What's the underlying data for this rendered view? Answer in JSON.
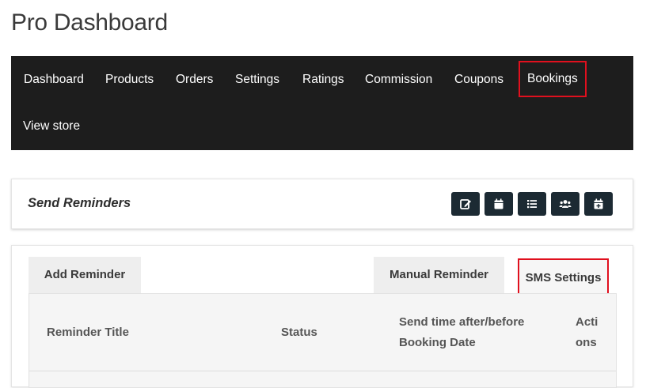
{
  "page": {
    "title": "Pro Dashboard"
  },
  "nav": {
    "items": [
      {
        "label": "Dashboard"
      },
      {
        "label": "Products"
      },
      {
        "label": "Orders"
      },
      {
        "label": "Settings"
      },
      {
        "label": "Ratings"
      },
      {
        "label": "Commission"
      },
      {
        "label": "Coupons"
      },
      {
        "label": "Bookings"
      },
      {
        "label": "View store"
      }
    ]
  },
  "reminders": {
    "title": "Send Reminders",
    "toolbar": [
      {
        "icon": "edit-icon"
      },
      {
        "icon": "calendar-icon"
      },
      {
        "icon": "list-icon"
      },
      {
        "icon": "users-icon"
      },
      {
        "icon": "calendar-plus-icon"
      }
    ]
  },
  "tabs": [
    {
      "label": "Add Reminder"
    },
    {
      "label": "Manual Reminder"
    },
    {
      "label": "SMS Settings"
    }
  ],
  "table": {
    "columns": [
      {
        "label": "Reminder Title"
      },
      {
        "label": "Status"
      },
      {
        "label": "Send time after/before Booking Date"
      },
      {
        "label": "Actions"
      }
    ]
  },
  "colors": {
    "navbar_bg": "#1d1d1d",
    "highlight": "#e0101e",
    "tool_btn_bg": "#1c2a33"
  }
}
